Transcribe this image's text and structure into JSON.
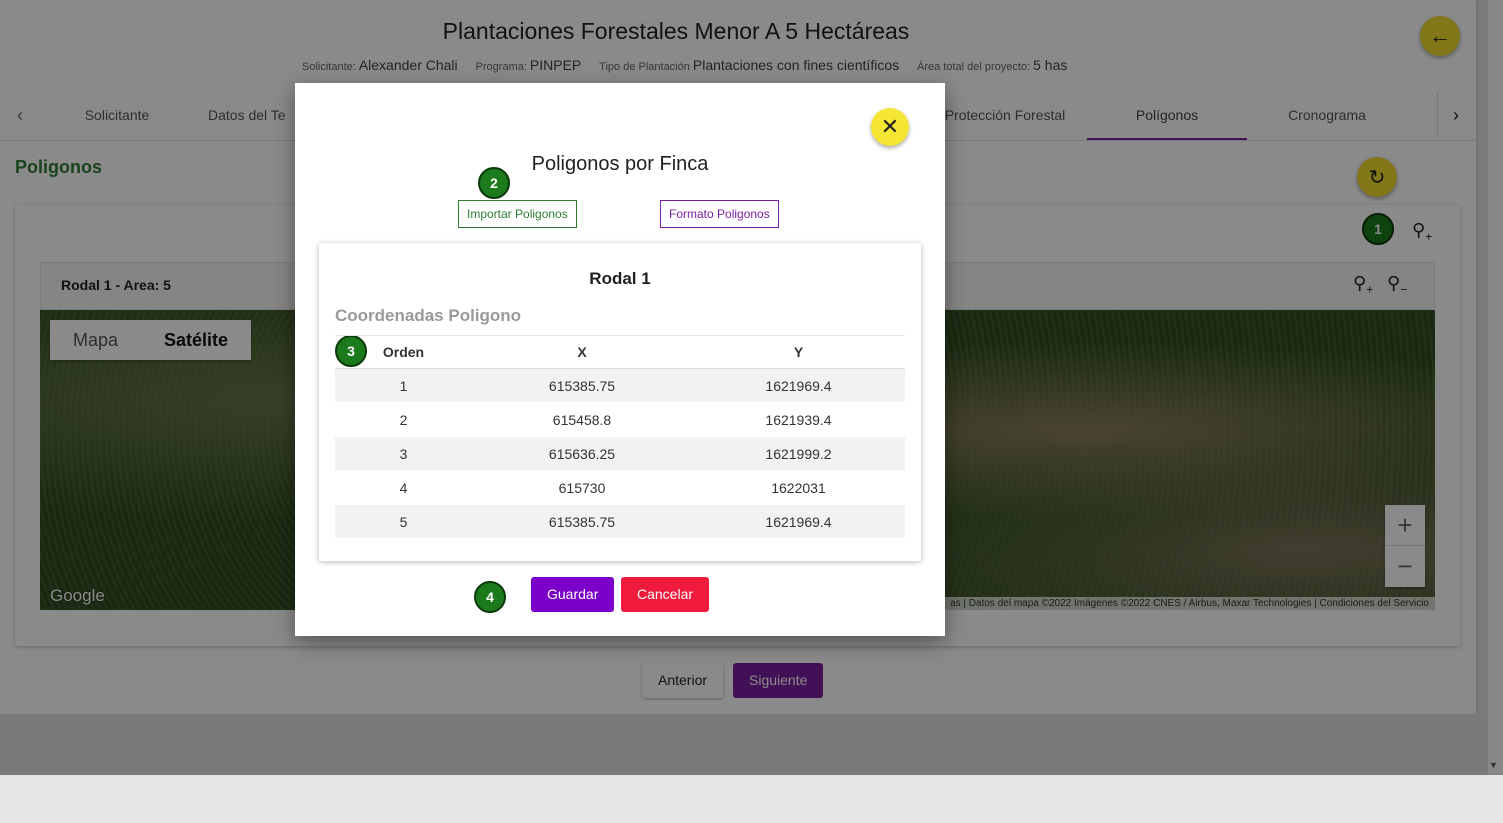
{
  "header": {
    "title": "Plantaciones Forestales Menor A 5 Hectáreas",
    "meta": [
      {
        "key": "Solicitante:",
        "value": "Alexander Chali"
      },
      {
        "key": "Programa:",
        "value": "PINPEP"
      },
      {
        "key": "Tipo de Plantación",
        "value": "Plantaciones con fines científicos"
      },
      {
        "key": "Área total del proyecto:",
        "value": "5 has"
      }
    ]
  },
  "tabs": [
    "Solicitante",
    "Datos del Te",
    "Protección Forestal",
    "Polígonos",
    "Cronograma"
  ],
  "section": {
    "title": "Poligonos"
  },
  "rodal": {
    "label": "Rodal 1 - Area: 5"
  },
  "map": {
    "toggle_map": "Mapa",
    "toggle_satellite": "Satélite",
    "google": "Google",
    "attribution_left": "as",
    "attribution_data": "Datos del mapa ©2022 Imágenes ©2022 CNES / Airbus, Maxar Technologies",
    "attribution_terms": "Condiciones del Servicio",
    "zoom_in": "+",
    "zoom_out": "−"
  },
  "nav": {
    "prev": "Anterior",
    "next": "Siguiente"
  },
  "steps": [
    "1",
    "2",
    "3",
    "4"
  ],
  "dialog": {
    "title": "Poligonos por Finca",
    "import_button": "Importar Poligonos",
    "format_button": "Formato Poligonos",
    "card_title": "Rodal 1",
    "coords_title": "Coordenadas Poligono",
    "columns": [
      "Orden",
      "X",
      "Y"
    ],
    "rows": [
      [
        "1",
        "615385.75",
        "1621969.4"
      ],
      [
        "2",
        "615458.8",
        "1621939.4"
      ],
      [
        "3",
        "615636.25",
        "1621999.2"
      ],
      [
        "4",
        "615730",
        "1622031"
      ],
      [
        "5",
        "615385.75",
        "1621969.4"
      ]
    ],
    "save": "Guardar",
    "cancel": "Cancelar"
  },
  "icons": {
    "back": "arrow-left-icon",
    "refresh": "refresh-icon",
    "close": "close-icon",
    "add_pin": "map-pin-add-icon",
    "remove_pin": "map-pin-remove-icon"
  },
  "colors": {
    "accent": "#7b1fa2",
    "green": "#2e7d32",
    "yellow": "#f0dc2e",
    "danger": "#f01a3c"
  }
}
